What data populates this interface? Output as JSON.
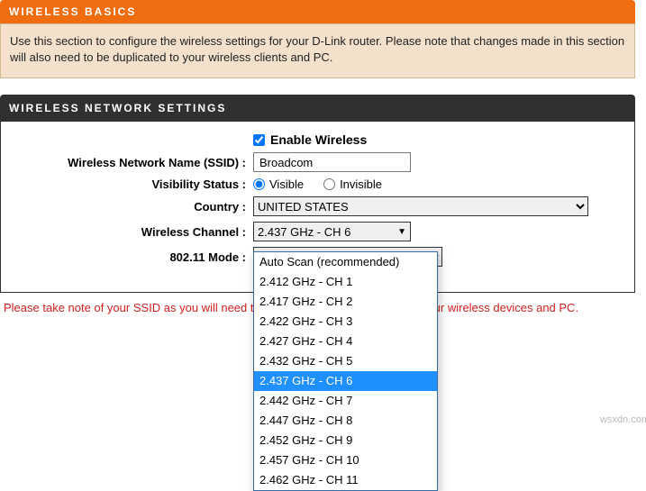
{
  "basics": {
    "title": "WIRELESS BASICS",
    "desc": "Use this section to configure the wireless settings for your D-Link router. Please note that changes made in this section will also need to be duplicated to your wireless clients and PC."
  },
  "settings": {
    "title": "WIRELESS NETWORK SETTINGS",
    "enable_label": "Enable Wireless",
    "enable_checked": true,
    "ssid_label": "Wireless Network Name (SSID) :",
    "ssid_value": "Broadcom",
    "visibility_label": "Visibility Status :",
    "visible_text": "Visible",
    "invisible_text": "Invisible",
    "country_label": "Country :",
    "country_value": "UNITED STATES",
    "channel_label": "Wireless Channel :",
    "channel_value": "2.437 GHz - CH 6",
    "mode_label": "802.11 Mode :",
    "mode_value": ""
  },
  "channel_options": [
    "Auto Scan (recommended)",
    "2.412 GHz - CH 1",
    "2.417 GHz - CH 2",
    "2.422 GHz - CH 3",
    "2.427 GHz - CH 4",
    "2.432 GHz - CH 5",
    "2.437 GHz - CH 6",
    "2.442 GHz - CH 7",
    "2.447 GHz - CH 8",
    "2.452 GHz - CH 9",
    "2.457 GHz - CH 10",
    "2.462 GHz - CH 11"
  ],
  "note": "Please take note of your SSID as you will need to duplicate the same settings to your wireless devices and PC.",
  "watermark": "wsxdn.com"
}
